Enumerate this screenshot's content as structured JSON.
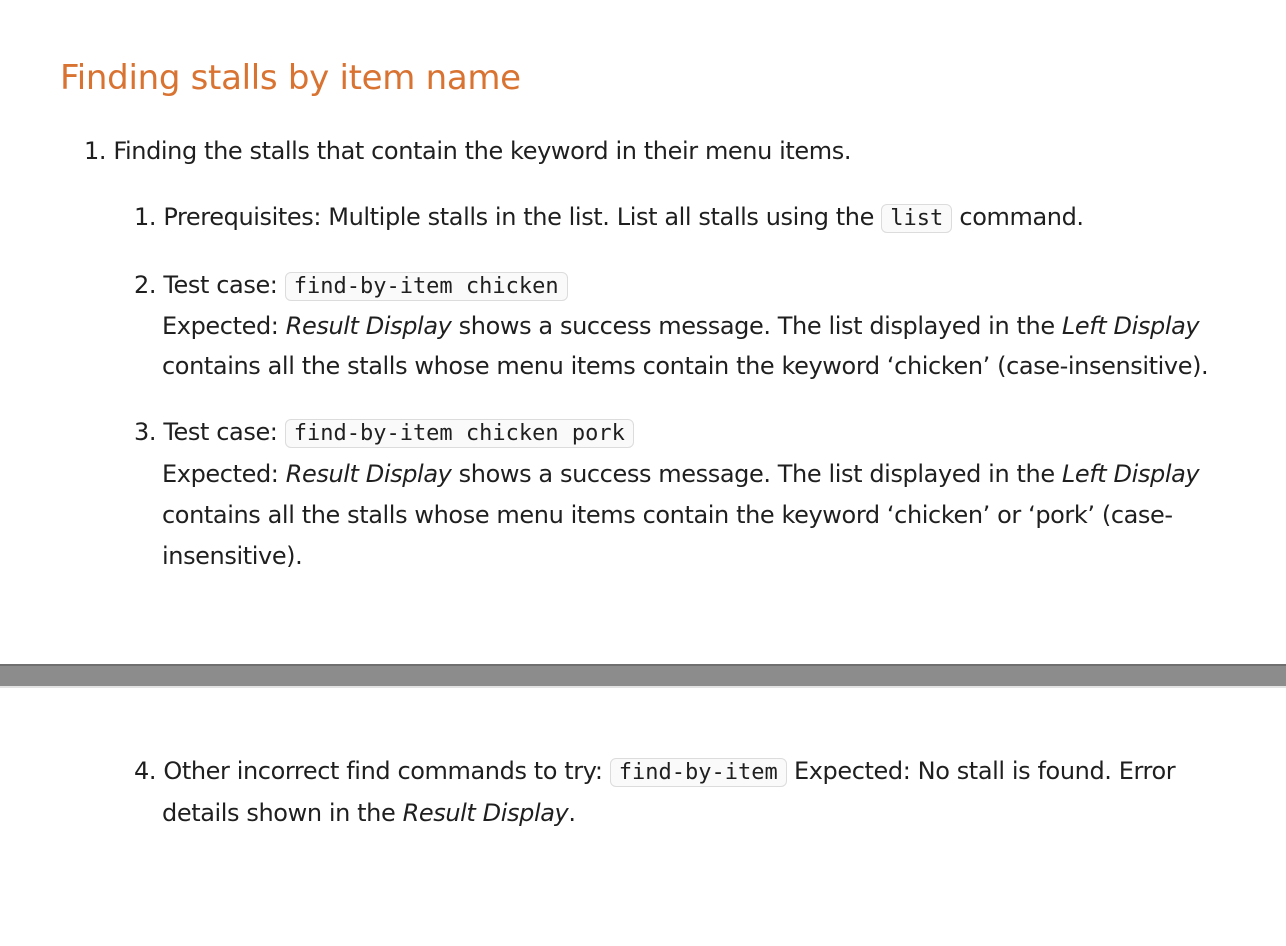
{
  "heading": "Finding stalls by item name",
  "item1": {
    "number": "1.",
    "text": "Finding the stalls that contain the keyword in their menu items."
  },
  "sub1": {
    "number": "1.",
    "before": "Prerequisites: Multiple stalls in the list. List all stalls using the",
    "code": "list",
    "after": "command."
  },
  "sub2": {
    "number": "2.",
    "label": "Test case:",
    "code": "find-by-item chicken",
    "expected_prefix": "Expected:",
    "result_display": "Result Display",
    "mid": "shows a success message. The list displayed in the",
    "left_display": "Left Display",
    "line2": "contains all the stalls whose menu items contain the keyword ‘chicken’ (case-insensitive)."
  },
  "sub3": {
    "number": "3.",
    "label": "Test case:",
    "code": "find-by-item chicken pork",
    "expected_prefix": "Expected:",
    "result_display": "Result Display",
    "mid": "shows a success message. The list displayed in the",
    "left_display": "Left Display",
    "line2": "contains all the stalls whose menu items contain the keyword ‘chicken’ or ‘pork’ (case-",
    "line3": "insensitive)."
  },
  "sub4": {
    "number": "4.",
    "before": "Other incorrect find commands to try:",
    "code": "find-by-item",
    "after": "Expected: No stall is found. Error",
    "line2_before": "details shown in the",
    "result_display": "Result Display",
    "line2_after": "."
  }
}
